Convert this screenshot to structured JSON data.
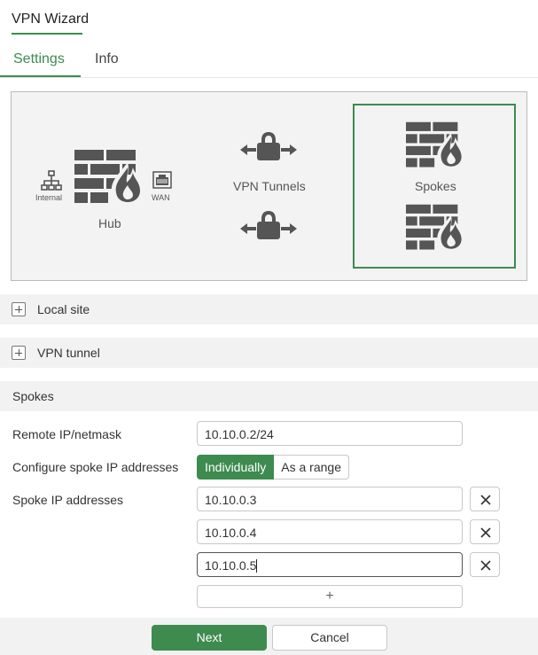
{
  "window": {
    "title": "VPN Wizard"
  },
  "tabs": [
    {
      "label": "Settings",
      "active": true
    },
    {
      "label": "Info",
      "active": false
    }
  ],
  "diagram": {
    "hub_label": "Hub",
    "internal_label": "Internal",
    "wan_label": "WAN",
    "tunnels_label": "VPN Tunnels",
    "spokes_label": "Spokes",
    "icons": [
      "network-icon",
      "firewall-icon",
      "wan-port-icon",
      "lock-arrows-icon"
    ]
  },
  "sections": {
    "local_site": "Local site",
    "vpn_tunnel": "VPN tunnel",
    "spokes": "Spokes"
  },
  "form": {
    "remote_ip_label": "Remote IP/netmask",
    "remote_ip_value": "10.10.0.2/24",
    "configure_label": "Configure spoke IP addresses",
    "configure_options": [
      "Individually",
      "As a range"
    ],
    "configure_selected": "Individually",
    "spoke_ips_label": "Spoke IP addresses",
    "spoke_ips": [
      "10.10.0.3",
      "10.10.0.4",
      "10.10.0.5"
    ],
    "add_label": "+"
  },
  "footer": {
    "next_label": "Next",
    "cancel_label": "Cancel"
  },
  "colors": {
    "accent": "#3d8b4f",
    "icon": "#555555",
    "panel_bg": "#f3f3f3"
  }
}
